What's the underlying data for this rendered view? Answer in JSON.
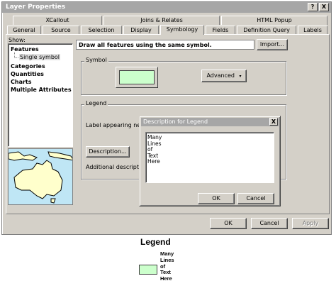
{
  "window": {
    "title": "Layer Properties",
    "help_btn": "?",
    "close_btn": "X"
  },
  "tabs_row1": [
    "XCallout",
    "Joins & Relates",
    "HTML Popup"
  ],
  "tabs_row2": [
    "General",
    "Source",
    "Selection",
    "Display",
    "Symbology",
    "Fields",
    "Definition Query",
    "Labels"
  ],
  "active_tab": "Symbology",
  "show_panel": {
    "label": "Show:",
    "items": [
      {
        "label": "Features",
        "bold": true
      },
      {
        "label": "Single symbol",
        "bold": false,
        "selected": true
      },
      {
        "label": "Categories",
        "bold": true
      },
      {
        "label": "Quantities",
        "bold": true
      },
      {
        "label": "Charts",
        "bold": true
      },
      {
        "label": "Multiple Attributes",
        "bold": true
      }
    ]
  },
  "symbology": {
    "heading": "Draw all features using the same symbol.",
    "import_label": "Import...",
    "symbol_group": "Symbol",
    "advanced_label": "Advanced",
    "symbol_color": "#ccffcc",
    "legend_group": "Legend",
    "label_text": "Label appearing next t",
    "description_btn": "Description...",
    "additional_desc": "Additional description"
  },
  "dialog_buttons": {
    "ok": "OK",
    "cancel": "Cancel",
    "apply": "Apply"
  },
  "desc_dialog": {
    "title": "Description for Legend",
    "close": "X",
    "lines": [
      "Many",
      "Lines",
      "of",
      "Text",
      "Here"
    ],
    "ok": "OK",
    "cancel": "Cancel"
  },
  "legend_output": {
    "title": "Legend",
    "lines": [
      "Many",
      "Lines",
      "of",
      "Text",
      "Here"
    ],
    "swatch_color": "#ccffcc"
  }
}
